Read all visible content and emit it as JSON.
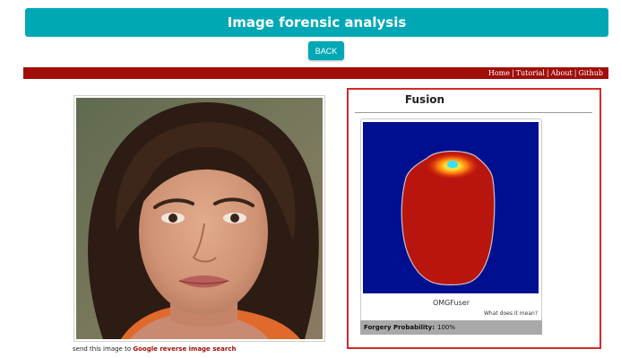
{
  "header": {
    "title": "Image forensic analysis"
  },
  "back_button": {
    "label": "BACK"
  },
  "nav": {
    "items": [
      {
        "label": "Home"
      },
      {
        "label": "Tutorial"
      },
      {
        "label": "About"
      },
      {
        "label": "Github"
      }
    ],
    "separator": "|"
  },
  "photo": {
    "caption_prefix": "send this image to",
    "caption_link": "Google reverse image search"
  },
  "result": {
    "heading": "Fusion",
    "method": "OMGFuser",
    "meaning_link": "What does it mean?",
    "probability_label": "Forgery Probability:",
    "probability_value": "100%"
  },
  "colors": {
    "accent": "#00a8b5",
    "nav_bar": "#a00e0a",
    "panel_border": "#d42a2a",
    "heatmap_background": "#000f8f",
    "heatmap_region": "#b8150e"
  },
  "icons": [
    "face-photo-image",
    "forgery-heatmap-image"
  ]
}
